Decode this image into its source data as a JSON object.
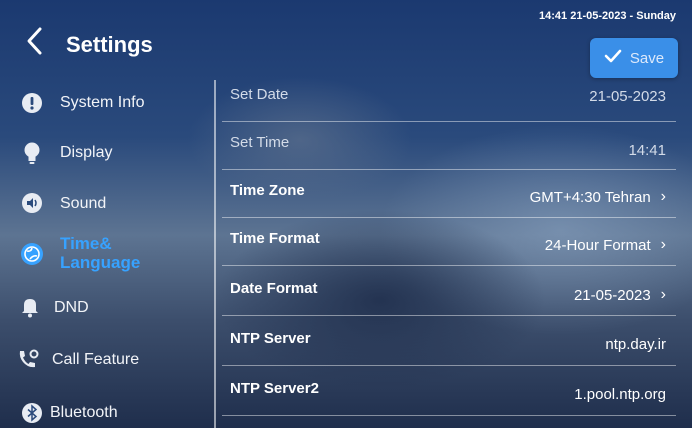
{
  "status_bar": {
    "datetime": "14:41  21-05-2023 - Sunday"
  },
  "header": {
    "title": "Settings",
    "back_icon": "chevron-left-icon"
  },
  "toolbar": {
    "save_label": "Save",
    "save_icon": "check-icon"
  },
  "colors": {
    "accent": "#3a8fe8",
    "active_text": "#37a2ff"
  },
  "sidebar": {
    "items": [
      {
        "label": "System Info",
        "icon": "info-icon"
      },
      {
        "label": "Display",
        "icon": "bulb-icon"
      },
      {
        "label": "Sound",
        "icon": "speaker-icon"
      },
      {
        "label": "Time&",
        "label2": "Language",
        "icon": "globe-icon",
        "active": true
      },
      {
        "label": "DND",
        "icon": "bell-icon"
      },
      {
        "label": "Call Feature",
        "icon": "phone-gear-icon"
      },
      {
        "label": "Bluetooth",
        "icon": "bluetooth-icon"
      }
    ]
  },
  "settings": [
    {
      "label": "Set Date",
      "value": "21-05-2023"
    },
    {
      "label": "Set Time",
      "value": "14:41"
    },
    {
      "label": "Time Zone",
      "value": "GMT+4:30 Tehran"
    },
    {
      "label": "Time Format",
      "value": "24-Hour Format"
    },
    {
      "label": "Date Format",
      "value": "21-05-2023"
    },
    {
      "label": "NTP Server",
      "value": "ntp.day.ir"
    },
    {
      "label": "NTP Server2",
      "value": "1.pool.ntp.org"
    }
  ]
}
